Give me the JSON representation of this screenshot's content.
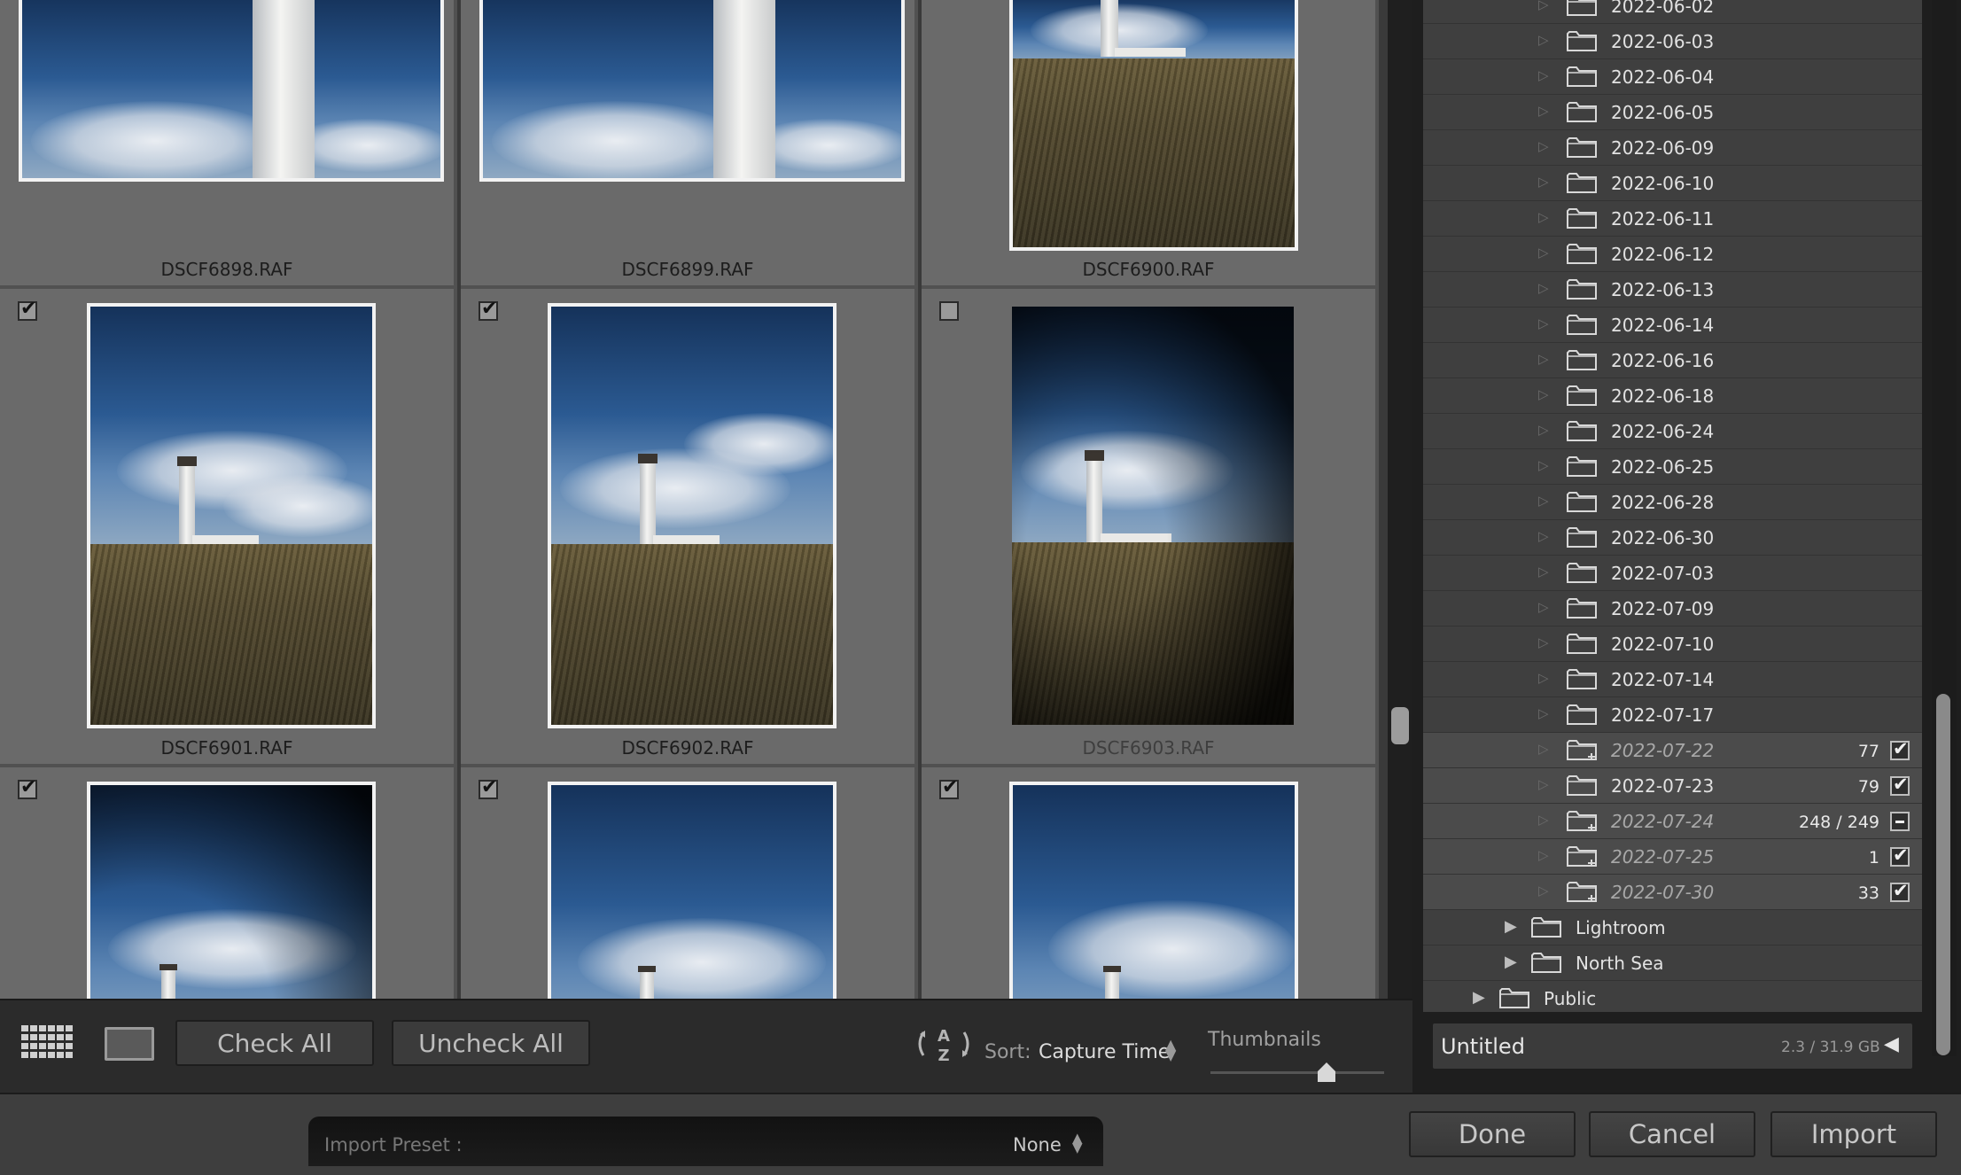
{
  "grid": {
    "cells": [
      {
        "filename": "DSCF6898.RAF",
        "checked": null
      },
      {
        "filename": "DSCF6899.RAF",
        "checked": null
      },
      {
        "filename": "DSCF6900.RAF",
        "checked": null
      },
      {
        "filename": "DSCF6901.RAF",
        "checked": true
      },
      {
        "filename": "DSCF6902.RAF",
        "checked": true
      },
      {
        "filename": "DSCF6903.RAF",
        "checked": false
      },
      {
        "filename": "",
        "checked": true
      },
      {
        "filename": "",
        "checked": true
      },
      {
        "filename": "",
        "checked": true
      }
    ]
  },
  "toolbar": {
    "grid_view_icon": "grid-view-icon",
    "loupe_view_icon": "loupe-view-icon",
    "check_all_label": "Check All",
    "uncheck_all_label": "Uncheck All",
    "sort_icon": "sort-az-icon",
    "sort_label": "Sort:",
    "sort_value": "Capture Time",
    "thumbnails_label": "Thumbnails",
    "thumbnails_size_fraction": 0.67
  },
  "folders": {
    "dated": [
      {
        "label": "2022-06-02",
        "is_new": false,
        "count": "",
        "check": ""
      },
      {
        "label": "2022-06-03",
        "is_new": false,
        "count": "",
        "check": ""
      },
      {
        "label": "2022-06-04",
        "is_new": false,
        "count": "",
        "check": ""
      },
      {
        "label": "2022-06-05",
        "is_new": false,
        "count": "",
        "check": ""
      },
      {
        "label": "2022-06-09",
        "is_new": false,
        "count": "",
        "check": ""
      },
      {
        "label": "2022-06-10",
        "is_new": false,
        "count": "",
        "check": ""
      },
      {
        "label": "2022-06-11",
        "is_new": false,
        "count": "",
        "check": ""
      },
      {
        "label": "2022-06-12",
        "is_new": false,
        "count": "",
        "check": ""
      },
      {
        "label": "2022-06-13",
        "is_new": false,
        "count": "",
        "check": ""
      },
      {
        "label": "2022-06-14",
        "is_new": false,
        "count": "",
        "check": ""
      },
      {
        "label": "2022-06-16",
        "is_new": false,
        "count": "",
        "check": ""
      },
      {
        "label": "2022-06-18",
        "is_new": false,
        "count": "",
        "check": ""
      },
      {
        "label": "2022-06-24",
        "is_new": false,
        "count": "",
        "check": ""
      },
      {
        "label": "2022-06-25",
        "is_new": false,
        "count": "",
        "check": ""
      },
      {
        "label": "2022-06-28",
        "is_new": false,
        "count": "",
        "check": ""
      },
      {
        "label": "2022-06-30",
        "is_new": false,
        "count": "",
        "check": ""
      },
      {
        "label": "2022-07-03",
        "is_new": false,
        "count": "",
        "check": ""
      },
      {
        "label": "2022-07-09",
        "is_new": false,
        "count": "",
        "check": ""
      },
      {
        "label": "2022-07-10",
        "is_new": false,
        "count": "",
        "check": ""
      },
      {
        "label": "2022-07-14",
        "is_new": false,
        "count": "",
        "check": ""
      },
      {
        "label": "2022-07-17",
        "is_new": false,
        "count": "",
        "check": ""
      },
      {
        "label": "2022-07-22",
        "is_new": true,
        "count": "77",
        "check": "on"
      },
      {
        "label": "2022-07-23",
        "is_new": false,
        "count": "79",
        "check": "on"
      },
      {
        "label": "2022-07-24",
        "is_new": true,
        "count": "248 / 249",
        "check": "part"
      },
      {
        "label": "2022-07-25",
        "is_new": true,
        "count": "1",
        "check": "on"
      },
      {
        "label": "2022-07-30",
        "is_new": true,
        "count": "33",
        "check": "on"
      }
    ],
    "parents": [
      {
        "label": "Lightroom"
      },
      {
        "label": "North Sea"
      },
      {
        "label": "Public"
      }
    ],
    "folder_icon": "folder-icon",
    "disclosure_icon": "disclosure-triangle-icon"
  },
  "destination": {
    "name": "Untitled",
    "size": "2.3 / 31.9 GB",
    "arrow_icon": "collapse-left-arrow-icon"
  },
  "bottom": {
    "preset_label": "Import Preset :",
    "preset_value": "None",
    "done_label": "Done",
    "cancel_label": "Cancel",
    "import_label": "Import"
  },
  "colors": {
    "grid_cell": "#6a6a6a",
    "panel": "#3f3f3f",
    "selected_row": "#4b4b4b",
    "sky_blue": "#2b5a92"
  }
}
